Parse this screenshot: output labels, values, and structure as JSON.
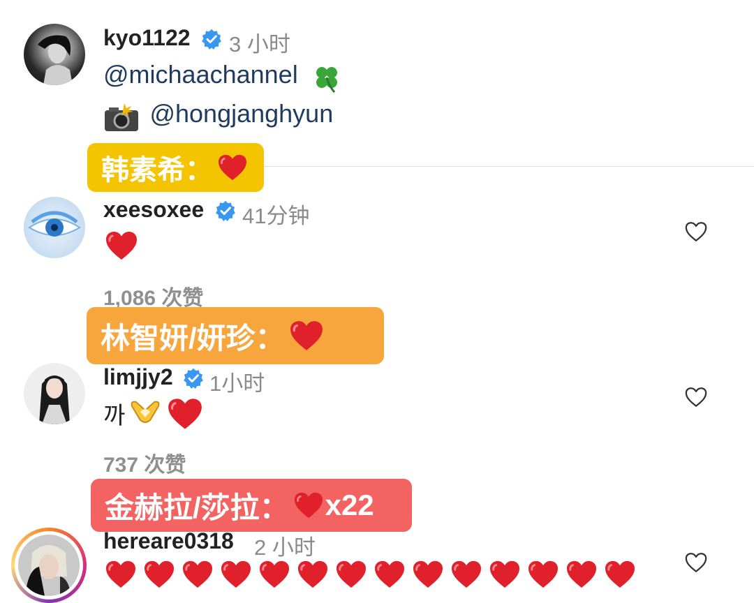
{
  "comments": [
    {
      "username": "kyo1122",
      "time": "3 小时",
      "line1": "@michaachannel",
      "line2": "@hongjanghyun"
    },
    {
      "username": "xeesoxee",
      "time": "41分钟",
      "likes": "1,086 次赞"
    },
    {
      "username": "limjjy2",
      "time": "1小时",
      "text": "까",
      "likes": "737 次赞"
    },
    {
      "username": "hereare0318",
      "time": "2 小时",
      "heart_count": 14
    }
  ],
  "overlays": [
    {
      "label": "韩素希：",
      "color": "#f5c400"
    },
    {
      "label": "林智妍/妍珍：",
      "color": "#f6a63c"
    },
    {
      "label": "金赫拉/莎拉：",
      "suffix": "x22",
      "color": "#f26361"
    }
  ],
  "icons": {
    "verified": "verified-badge-icon",
    "like": "heart-outline-icon",
    "clover": "four-leaf-clover-icon",
    "camera": "camera-flash-icon",
    "hands": "heart-hands-icon"
  },
  "colors": {
    "verified": "#3897f0",
    "heart": "#e0202b",
    "muted": "#8a8a8a"
  }
}
